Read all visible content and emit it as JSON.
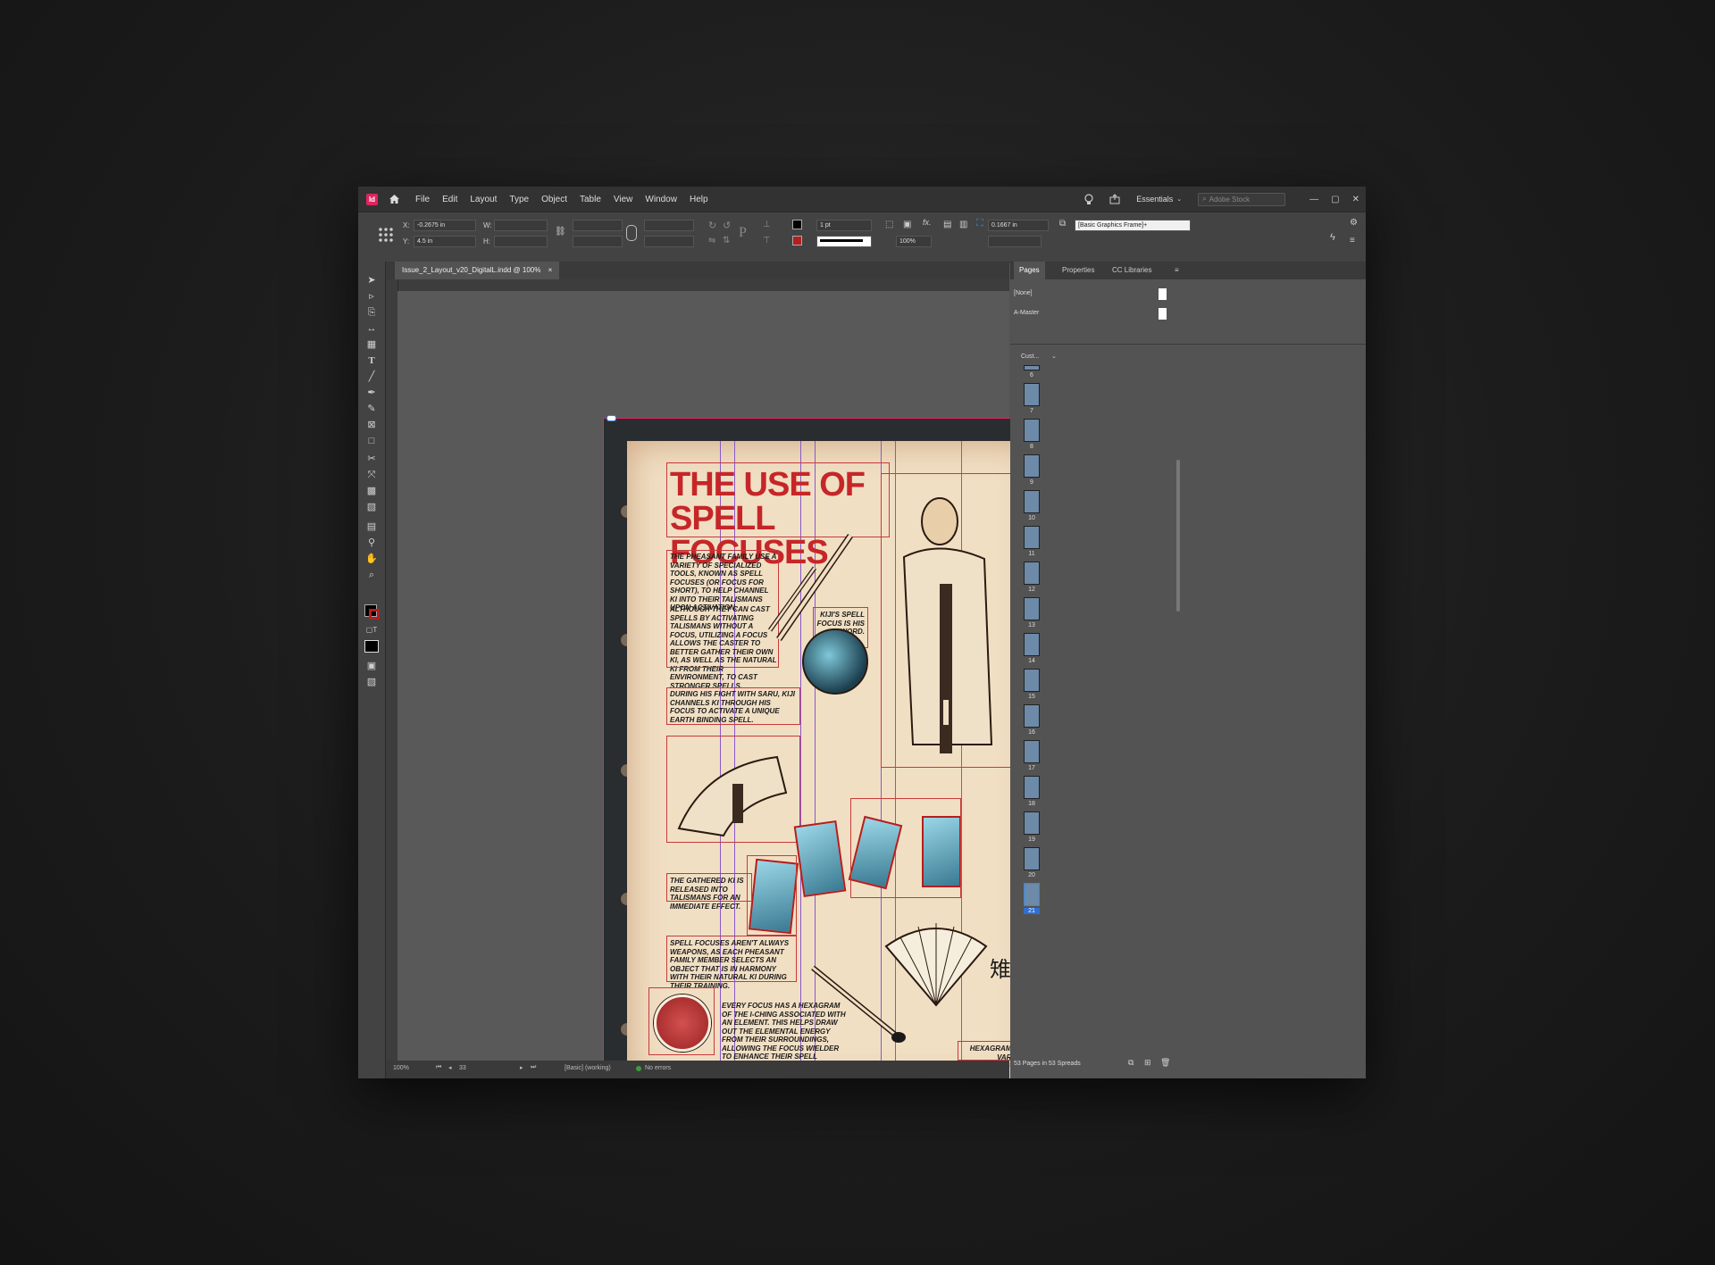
{
  "app": {
    "menu": [
      "File",
      "Edit",
      "Layout",
      "Type",
      "Object",
      "Table",
      "View",
      "Window",
      "Help"
    ],
    "workspace": "Essentials",
    "stock_placeholder": "Adobe Stock"
  },
  "control": {
    "x_label": "X:",
    "x_value": "-0.2675 in",
    "y_label": "Y:",
    "y_value": "4.5 in",
    "w_label": "W:",
    "h_label": "H:",
    "stroke_weight": "1 pt",
    "opacity": "100%",
    "offset": "0.1667 in",
    "object_style": "[Basic Graphics Frame]+"
  },
  "document": {
    "tab_label": "Issue_2_Layout_v20_DigitalL.indd @ 100%",
    "close_label": "×"
  },
  "page_content": {
    "title_line1": "THE USE OF",
    "title_line2": "SPELL FOCUSES",
    "para1": "The Pheasant family use a variety of specialized tools, known as spell focuses (or focus for short), to help channel ki into their talismans upon activation.",
    "para2": "Although they can cast spells by activating talismans without a focus, utilizing a focus allows the caster to better gather their own ki, as well as the natural ki from their environment, to cast stronger spells.",
    "para3": "During his fight with Saru, Kiji channels ki through his focus to activate a unique Earth Binding spell.",
    "caption_sword": "Kiji's spell focus is his sword.",
    "para4": "The gathered ki is released into talismans for an immediate effect.",
    "para5": "Spell focuses aren't always weapons, as each Pheasant family member selects an object that is in harmony with their natural ki during their training.",
    "para6": "Every focus has a hexagram of the I-Ching associated with an element. This helps draw out the elemental energy from their surroundings, allowing the focus wielder to enhance their spell casting capabilities.",
    "caption_hex": "Hexagrams on various focuses",
    "kanji": "雉"
  },
  "status": {
    "zoom": "100%",
    "page": "33",
    "profile": "[Basic] (working)",
    "preflight": "No errors"
  },
  "panel": {
    "tabs": [
      "Pages",
      "Properties",
      "CC Libraries"
    ],
    "masters": [
      "[None]",
      "A-Master"
    ],
    "size_label": "Cust...",
    "pages": [
      "6",
      "7",
      "8",
      "9",
      "10",
      "11",
      "12",
      "13",
      "14",
      "15",
      "16",
      "17",
      "18",
      "19",
      "20",
      "21"
    ],
    "footer": "53 Pages in 53 Spreads"
  },
  "colors": {
    "accent_red": "#c62628",
    "page_bg": "#f1dfc4",
    "frame_red": "#c63a3a",
    "guide_purple": "#8a58c9",
    "selection_blue": "#3a86e0"
  }
}
